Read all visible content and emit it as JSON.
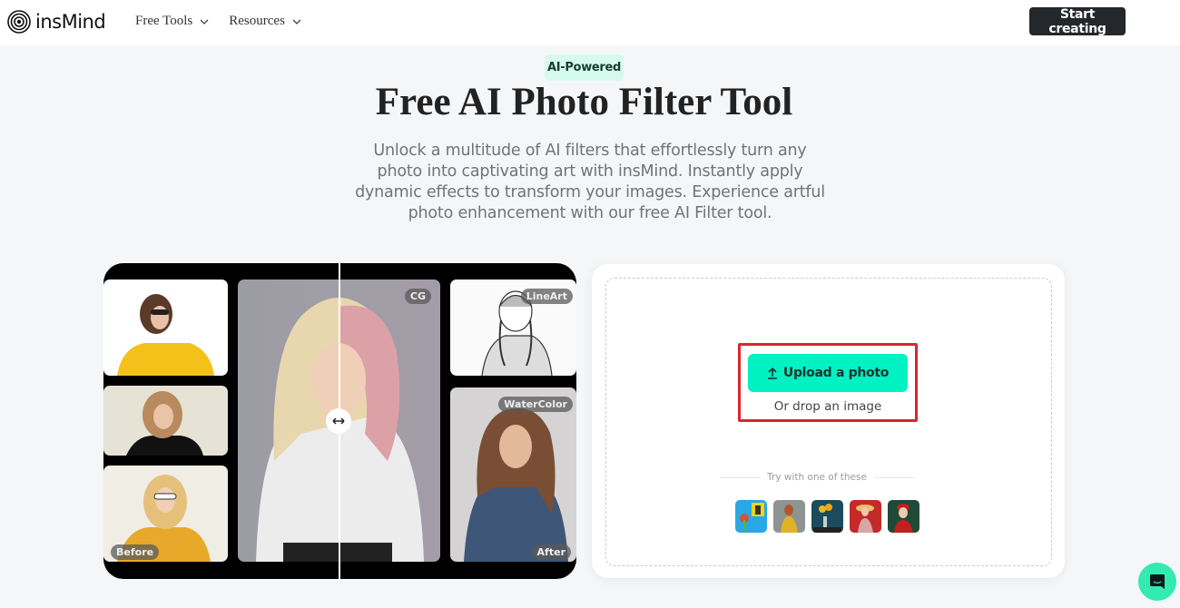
{
  "header": {
    "logo_text": "insMind",
    "nav": [
      {
        "label": "Free Tools"
      },
      {
        "label": "Resources"
      }
    ],
    "cta_label": "Start creating"
  },
  "hero": {
    "badge": "AI-Powered",
    "title": "Free AI Photo Filter Tool",
    "subtitle": "Unlock a multitude of AI filters that effortlessly turn any photo into captivating art with insMind. Instantly apply dynamic effects to transform your images. Experience artful photo enhancement with our free AI Filter tool."
  },
  "showcase": {
    "labels": {
      "before": "Before",
      "after": "After",
      "cg": "CG",
      "lineart": "LineArt",
      "watercolor": "WaterColor"
    }
  },
  "upload": {
    "button_label": "Upload a photo",
    "drop_text": "Or drop an image",
    "try_text": "Try with one of these",
    "samples": [
      {
        "name": "yellow-window-flowers"
      },
      {
        "name": "woman-yellow-dress"
      },
      {
        "name": "sunflowers-vase"
      },
      {
        "name": "woman-straw-hat-red"
      },
      {
        "name": "woman-red-beret"
      }
    ]
  },
  "colors": {
    "accent": "#00f2c3",
    "highlight_border": "#d9262e",
    "cta_bg": "#24272b",
    "badge_bg": "#d5fbee",
    "chat_bg": "#33eab0"
  }
}
